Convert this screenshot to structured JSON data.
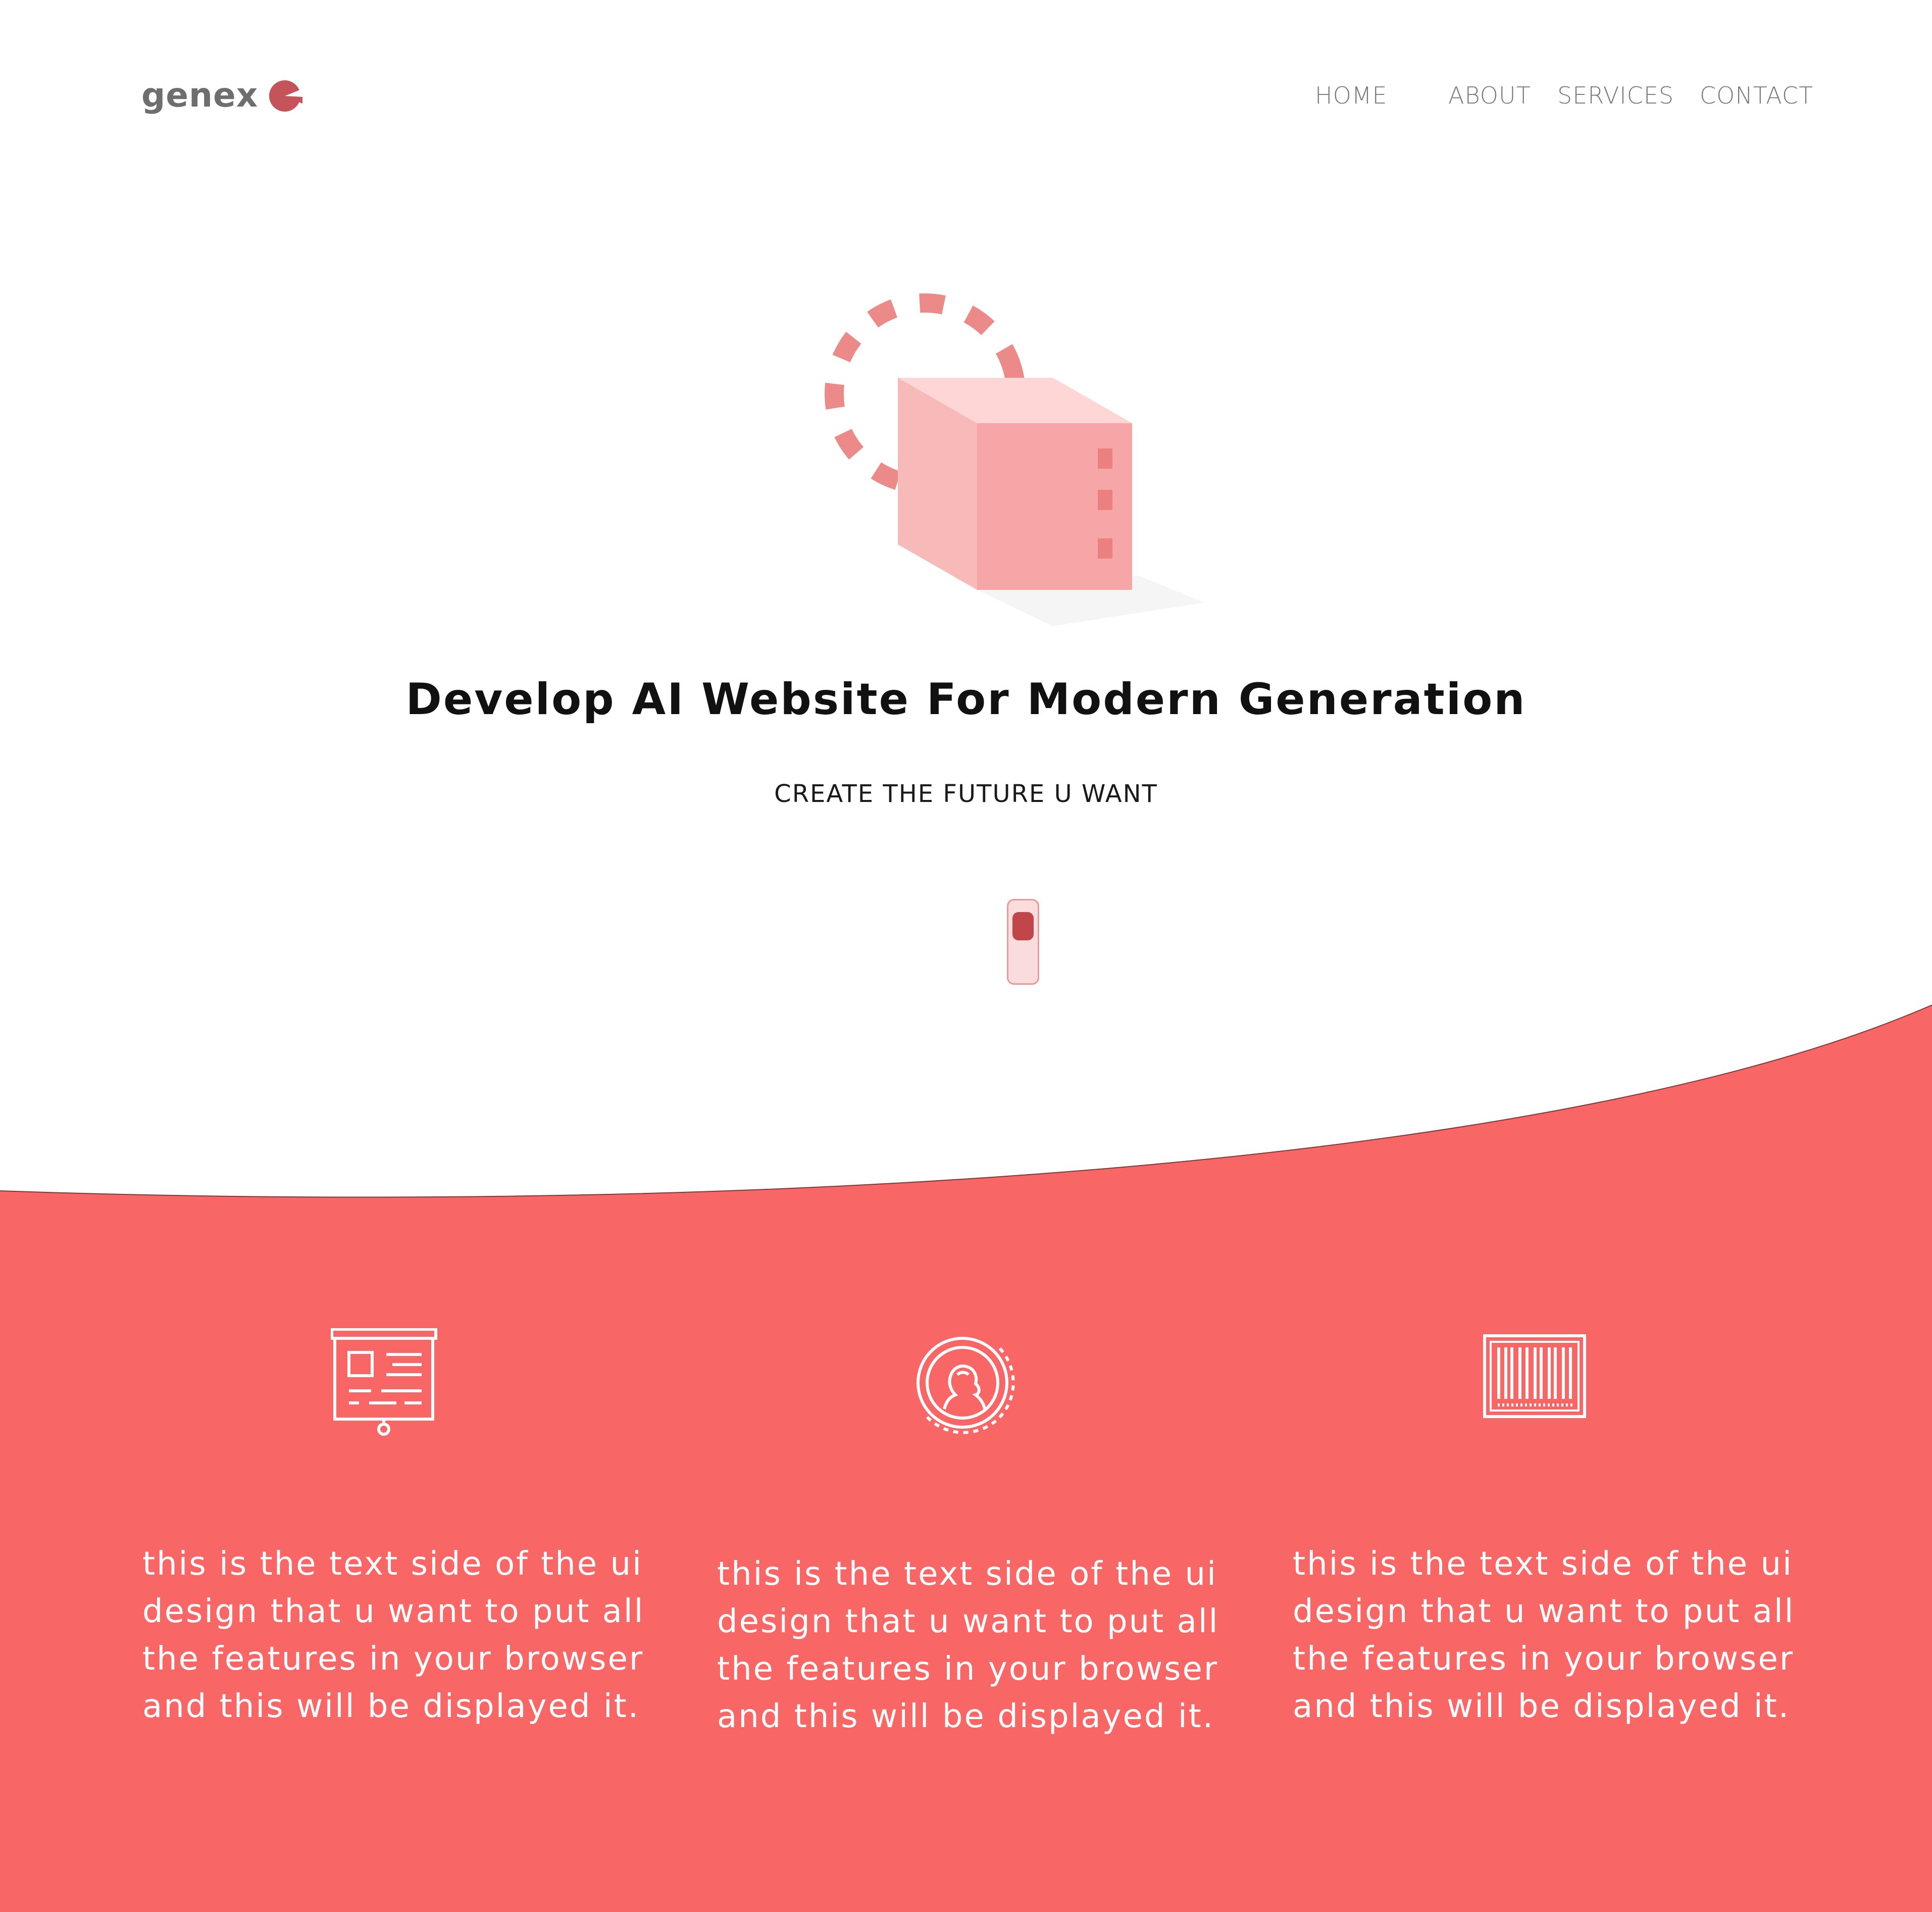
{
  "brand": {
    "name": "genex",
    "accent_color": "#c45459",
    "icon": "pacman-logo-icon"
  },
  "nav": {
    "items": [
      {
        "label": "HOME"
      },
      {
        "label": "ABOUT"
      },
      {
        "label": "SERVICES"
      },
      {
        "label": "CONTACT"
      }
    ]
  },
  "hero": {
    "illustration": "cube-with-dashed-circle",
    "headline": "Develop AI Website For Modern Generation",
    "subheadline": "CREATE THE FUTURE U WANT",
    "scroll_indicator": "mouse-scroll-icon"
  },
  "features": {
    "background_color": "#f86666",
    "items": [
      {
        "icon": "presentation-board-icon",
        "text": [
          "this is the text side of the ui",
          "design that u want to put all",
          "the features in your browser",
          "and this will be displayed it."
        ]
      },
      {
        "icon": "coin-portrait-icon",
        "text": [
          "this is the text side of the ui",
          "design that u want to put all",
          "the features in your browser",
          "and this will be displayed it."
        ]
      },
      {
        "icon": "barcode-icon",
        "text": [
          "this is the text side of the ui",
          "design that u want to put all",
          "the features in your browser",
          "and this will be displayed it."
        ]
      }
    ]
  }
}
